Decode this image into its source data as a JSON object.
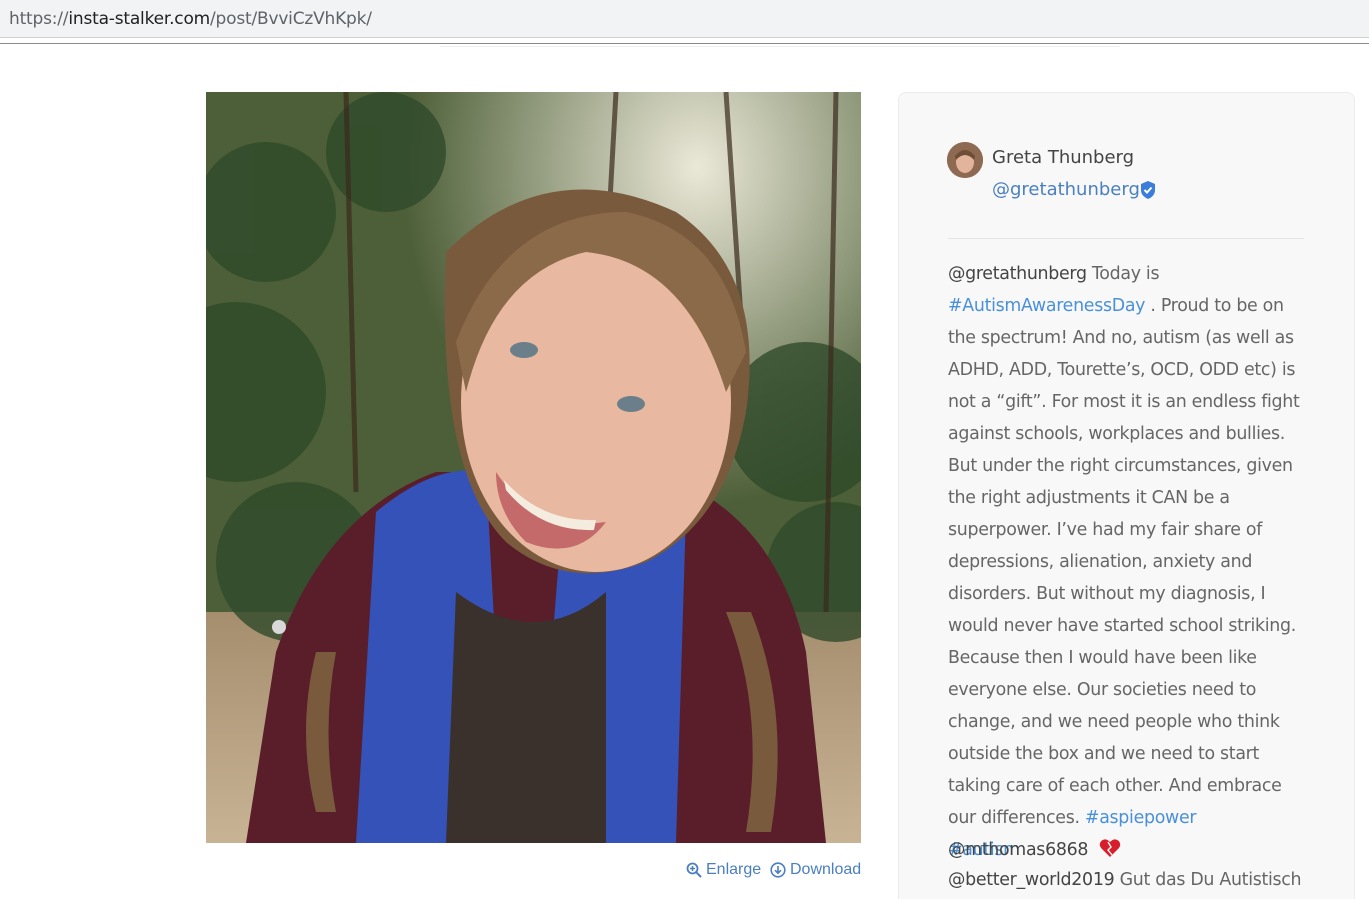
{
  "browser": {
    "url_prefix": "https://",
    "url_host": "insta-stalker.com",
    "url_path": "/post/BvviCzVhKpk/"
  },
  "post": {
    "image_alt": "Photo of a smiling girl with braids wearing a maroon jacket and blue hoodie",
    "actions": {
      "enlarge": "Enlarge",
      "download": "Download"
    }
  },
  "profile": {
    "name": "Greta Thunberg",
    "handle": "@gretathunberg",
    "verified_icon": "verified-badge-icon"
  },
  "caption": {
    "user": "@gretathunberg",
    "text_1": " Today is ",
    "tag_1": "#AutismAwarenessDay",
    "text_2": " . Proud to be on the spectrum! And no, autism (as well as ADHD, ADD, Tourette’s, OCD, ODD etc) is not a “gift”. For most it is an endless fight against schools, workplaces and bullies. But under the right circumstances, given the right adjustments it CAN be a superpower. I’ve had my fair share of depressions, alienation, anxiety and disorders. But without my diagnosis, I would never have started school striking. Because then I would have been like everyone else. Our societies need to change, and we need people who think outside the box and we need to start taking care of each other. And embrace our differences. ",
    "tag_2": "#aspiepower",
    "tag_3": "#autism"
  },
  "comments": [
    {
      "user": "@mthomas6868",
      "text": "",
      "icon": "heart-icon"
    },
    {
      "user": "@better_world2019",
      "text": " Gut das Du Autistisch"
    }
  ],
  "colors": {
    "link": "#4a90d9",
    "action": "#4a7fc1",
    "panel_bg": "#f8f8f8"
  }
}
